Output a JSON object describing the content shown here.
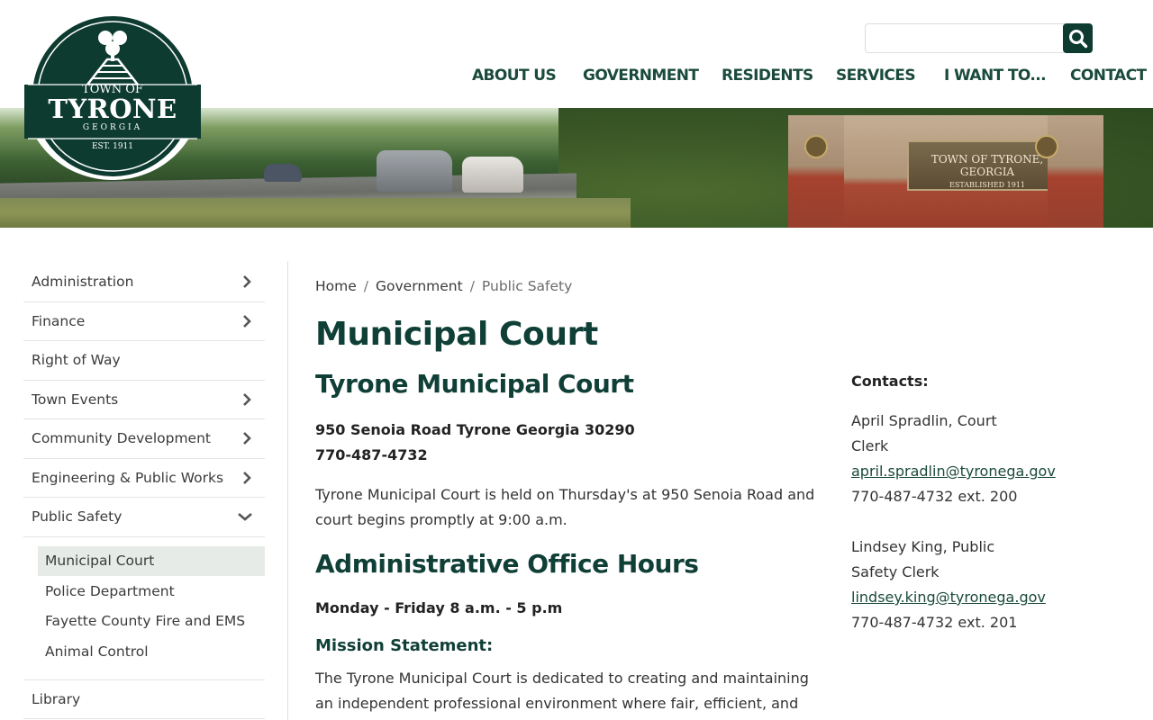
{
  "logo": {
    "top_text": "TOWN OF",
    "name": "TYRONE",
    "state": "GEORGIA",
    "est": "EST. 1911"
  },
  "search": {
    "placeholder": "",
    "value": ""
  },
  "nav": {
    "items": [
      "ABOUT US",
      "GOVERNMENT",
      "RESIDENTS",
      "SERVICES",
      "I WANT TO...",
      "CONTACT"
    ]
  },
  "banner": {
    "sign_title": "TOWN OF TYRONE, GEORGIA",
    "sign_sub": "ESTABLISHED 1911"
  },
  "sidebar": {
    "items": [
      {
        "label": "Administration",
        "chevron": "right"
      },
      {
        "label": "Finance",
        "chevron": "right"
      },
      {
        "label": "Right of Way",
        "chevron": ""
      },
      {
        "label": "Town Events",
        "chevron": "right"
      },
      {
        "label": "Community Development",
        "chevron": "right"
      },
      {
        "label": "Engineering & Public Works",
        "chevron": "right"
      },
      {
        "label": "Public Safety",
        "chevron": "down"
      }
    ],
    "sub_items": [
      "Municipal Court",
      "Police Department",
      "Fayette County Fire and EMS",
      "Animal Control"
    ],
    "after": "Library"
  },
  "breadcrumb": {
    "home": "Home",
    "level2": "Government",
    "current": "Public Safety"
  },
  "main": {
    "title": "Municipal Court",
    "subtitle": "Tyrone Municipal Court",
    "address": "950 Senoia Road Tyrone Georgia 30290",
    "phone": "770-487-4732",
    "schedule_text": "Tyrone Municipal Court is held on Thursday's  at 950 Senoia Road and court begins promptly at 9:00 a.m.",
    "office_hours_heading": "Administrative Office Hours",
    "office_hours": "Monday - Friday 8 a.m. - 5 p.m",
    "mission_heading": "Mission Statement:",
    "mission_text": "The Tyrone Municipal Court is dedicated to creating and maintaining an independent professional environment where fair, efficient, and"
  },
  "contacts": {
    "label": "Contacts:",
    "people": [
      {
        "name": "April Spradlin, Court",
        "name2": "Clerk",
        "email": "april.spradlin@tyronega.gov",
        "phone": "770-487-4732 ext. 200"
      },
      {
        "name": "Lindsey King, Public",
        "name2": "Safety Clerk",
        "email": "lindsey.king@tyronega.gov",
        "phone": "770-487-4732 ext. 201"
      }
    ]
  },
  "colors": {
    "brand": "#0e3b30",
    "heading": "#0f3f36",
    "nav": "#1a4a3c"
  }
}
